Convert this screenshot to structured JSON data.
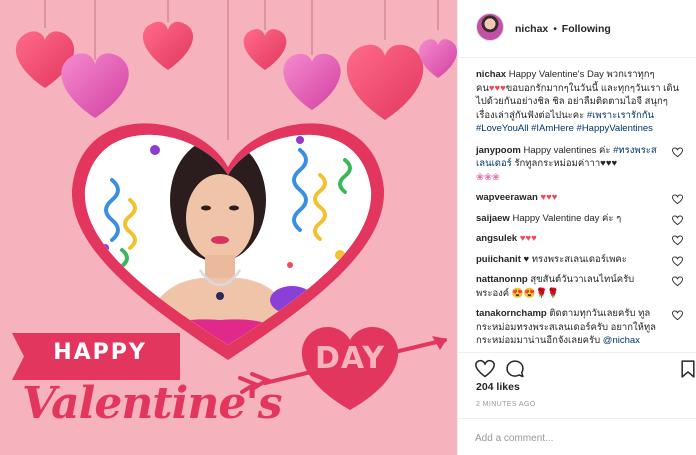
{
  "header": {
    "username": "nichax",
    "separator": "•",
    "follow_status": "Following"
  },
  "post_image": {
    "happy_text": "HAPPY",
    "day_text": "DAY",
    "valentines_text": "Valentine's",
    "colors": {
      "background": "#f7b3bd",
      "banner": "#e2365f",
      "heart": "#e2365f"
    }
  },
  "caption": {
    "username": "nichax",
    "text": "Happy Valentine's Day พวกเราทุกๆ คน",
    "hearts": "♥♥♥",
    "text2": "ขอบอกรักมากๆในวันนี้ และทุกๆวันเรา เดินไปด้วยกันอย่างชิล ชิล อย่าลืมติดตามไอจี สนุกๆเรื่องเล่าสู่กันฟังต่อไปนะคะ",
    "tag1": "#เพราะเรารักกัน",
    "tag2": "#LoveYouAll",
    "tag3": "#IAmHere",
    "tag4": "#HappyValentines"
  },
  "comments": [
    {
      "username": "janypoom",
      "text": "Happy valentines ค่ะ",
      "tag": "#ทรงพระสเลนเดอร์",
      "text2": "รักทูลกระหม่อมค่าาา♥♥♥",
      "emoji": "❀❀❀"
    },
    {
      "username": "wapveerawan",
      "text": "♥♥♥"
    },
    {
      "username": "saijaew",
      "text": "Happy Valentine day ค่ะ ๆ"
    },
    {
      "username": "angsulek",
      "text": "♥♥♥"
    },
    {
      "username": "puiichanit",
      "text": "♥ ทรงพระสเลนเดอร์เพคะ"
    },
    {
      "username": "nattanonnp",
      "text": "สุขสันต์วันวาเลนไทน์ครับพระองค์ 😍😍🌹🌹"
    },
    {
      "username": "tanakornchamp",
      "text": "ติดตามทุกวันเลยครับ ทูลกระหม่อมทรงพระสเลนเดอร์ครับ อยากให้ทูลกระหม่อมมาน่านอีกจังเลยครับ",
      "tag": "@nichax"
    }
  ],
  "icons": {
    "like": "heart-outline-icon",
    "comment": "comment-bubble-icon",
    "save": "bookmark-icon"
  },
  "likes": "204 likes",
  "time": "2 MINUTES AGO",
  "add_comment": {
    "placeholder": "Add a comment..."
  }
}
